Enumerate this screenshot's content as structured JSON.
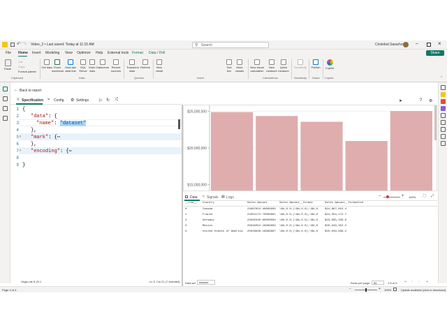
{
  "window": {
    "title": "Video_2 • Last saved: Today at 11:15 AM",
    "search": "Search",
    "user": "Cristobal Saracho",
    "share_label": "Share"
  },
  "menu_tabs": [
    "File",
    "Home",
    "Insert",
    "Modeling",
    "View",
    "Optimize",
    "Help",
    "External tools",
    "Format",
    "Data / Drill"
  ],
  "ribbon": {
    "clipboard": {
      "paste": "Paste",
      "cut": "Cut",
      "copy": "Copy",
      "format_painter": "Format painter",
      "group": "Clipboard"
    },
    "data": {
      "buttons": [
        "Get data",
        "Excel workbook",
        "OneLake data hub",
        "SQL Server",
        "Enter data",
        "Dataverse",
        "Recent sources"
      ],
      "group": "Data"
    },
    "queries": {
      "buttons": [
        "Transform data",
        "Refresh"
      ],
      "group": "Queries"
    },
    "insert": {
      "buttons": [
        "New visual",
        "Text box",
        "More visuals"
      ],
      "group": "Insert"
    },
    "calculations": {
      "buttons": [
        "New visual calculation",
        "New measure",
        "Quick measure"
      ],
      "group": "Calculations"
    },
    "sensitivity": {
      "buttons": [
        "Sensitivity"
      ],
      "group": "Sensitivity"
    },
    "share": {
      "buttons": [
        "Publish"
      ],
      "group": "Share"
    },
    "copilot": {
      "buttons": [
        "Copilot"
      ],
      "group": "Copilot"
    }
  },
  "back_label": "Back to report",
  "editor_tabs": {
    "specification": "Specification",
    "config": "Config",
    "settings": "Settings"
  },
  "code": {
    "line1": "{",
    "line2_key": "\"data\"",
    "line2_rest": ": {",
    "line3_key": "\"name\"",
    "line3_colon": ": ",
    "line3_val": "\"dataset\"",
    "line4": "},",
    "line5_key": "\"mark\"",
    "line5_rest": ": {⋯",
    "line8_key": "\"encoding\"",
    "line8_rest": ": {⋯",
    "line9": "}",
    "line_numbers": [
      "1",
      "2",
      "3",
      "4",
      "5",
      "6",
      "7",
      "8",
      "9"
    ]
  },
  "editor_status": {
    "left": "Vega-Lite 5.20.1",
    "right": "Ln 3, Col 21 (7 selected)"
  },
  "chart_data": {
    "type": "bar",
    "categories": [
      "Canada",
      "France",
      "Germany",
      "Mexico",
      "United States of America"
    ],
    "values": [
      24887654.4,
      24354172.7,
      23565340.6,
      20949352.2,
      25029838.2
    ],
    "ylim": [
      14200000,
      25800000
    ],
    "ticks": [
      "$25,000,000",
      "$20,000,000",
      "$15,000,000"
    ],
    "tick_values": [
      25000000,
      20000000,
      15000000
    ],
    "color": "#dfadad"
  },
  "bottom": {
    "tabs": [
      "Data",
      "Signals",
      "Logs"
    ],
    "zoom": "100%",
    "columns": [
      "__row__",
      "Country",
      "Sales Amount",
      "Sales Amount__format",
      "Sales Amount__formatted"
    ],
    "rows": [
      [
        "0",
        "Canada",
        "24887654.40899999",
        "\\$#,0.0;(\\$#,0.0);\\$#,0",
        "$24,887,654.4"
      ],
      [
        "1",
        "France",
        "24354172.70000001",
        "\\$#,0.0;(\\$#,0.0);\\$#,0",
        "$24,354,172.7"
      ],
      [
        "2",
        "Germany",
        "23565340.60000004",
        "\\$#,0.0;(\\$#,0.0);\\$#,0",
        "$23,565,340.6"
      ],
      [
        "3",
        "Mexico",
        "20949352.19999993",
        "\\$#,0.0;(\\$#,0.0);\\$#,0",
        "$20,949,352.2"
      ],
      [
        "4",
        "United States of America",
        "25029838.19999997",
        "\\$#,0.0;(\\$#,0.0);\\$#,0",
        "$25,029,838.2"
      ]
    ],
    "rows_per_page_label": "Rows per page:",
    "rows_per_page": "50",
    "range": "1-5 of 5",
    "dataset_label": "Data set",
    "dataset_value": "dataset"
  },
  "statusbar": {
    "page": "Page 4 of 4",
    "zoom": "100%",
    "update": "Update available (click to download)"
  }
}
